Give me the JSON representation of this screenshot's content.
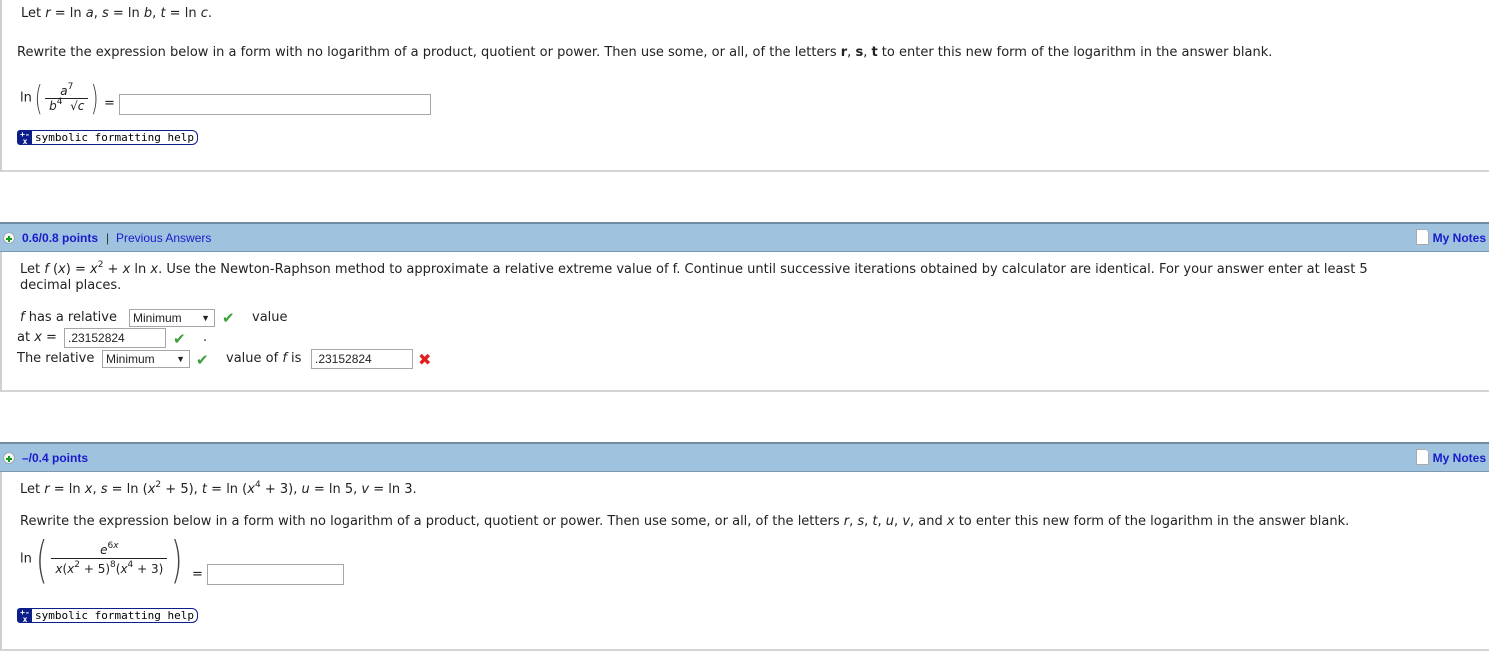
{
  "questions": [
    {
      "id": "q1",
      "given": {
        "prefix": "Let",
        "defs": "r = ln a, s = ln b, t = ln c."
      },
      "instruction_start": "Rewrite the expression below in a form with no logarithm of a product, quotient or power. Then use some, or all, of the letters ",
      "instruction_letters": [
        "r",
        "s",
        "t"
      ],
      "instruction_end": " to enter this new form of the logarithm in the answer blank.",
      "expression": {
        "fn": "ln",
        "numerator": "a",
        "numerator_exp": "7",
        "denominator_base": "b",
        "denominator_exp": "4",
        "denominator_root": "c"
      },
      "equals": "=",
      "answer_value": "",
      "help_label": "symbolic formatting help",
      "help_icon": "+-x"
    },
    {
      "id": "q2",
      "header": {
        "points": "0.6/0.8 points",
        "separator": "|",
        "link": "Previous Answers",
        "notes": "My Notes"
      },
      "prompt_line1": "Let f (x) = x² + x ln x. Use the Newton-Raphson method to approximate a relative extreme value of f. Continue until successive iterations obtained by calculator are identical. For your answer enter at least 5",
      "prompt_line2": "decimal places.",
      "row1": {
        "prefix": "f has a relative",
        "select": "Minimum",
        "status": "correct",
        "suffix": "value"
      },
      "row2": {
        "prefix": "at x =",
        "input": ".23152824",
        "status": "correct",
        "suffix": "."
      },
      "row3": {
        "prefix": "The relative",
        "select": "Minimum",
        "status": "correct",
        "middle": "value of f is",
        "input": ".23152824",
        "input_status": "incorrect"
      }
    },
    {
      "id": "q3",
      "header": {
        "points": "–/0.4 points",
        "notes": "My Notes"
      },
      "given": "Let r = ln x, s = ln (x² + 5), t = ln (x⁴ + 3), u = ln 5, v = ln 3.",
      "instruction": "Rewrite the expression below in a form with no logarithm of a product, quotient or power. Then use some, or all, of the letters r, s, t, u, v, and x to enter this new form of the logarithm in the answer blank.",
      "expression": {
        "fn": "ln",
        "numerator": "e",
        "numerator_exp": "6x",
        "denominator": "x(x² + 5)⁸(x⁴ + 3)"
      },
      "equals": "=",
      "answer_value": "",
      "help_label": "symbolic formatting help",
      "help_icon": "+-x"
    }
  ],
  "colors": {
    "header_bg": "#9fc2df",
    "link": "#1a1acb",
    "correct": "#3c9f3c",
    "incorrect": "#e02020",
    "help_button": "#0b1e8a"
  }
}
